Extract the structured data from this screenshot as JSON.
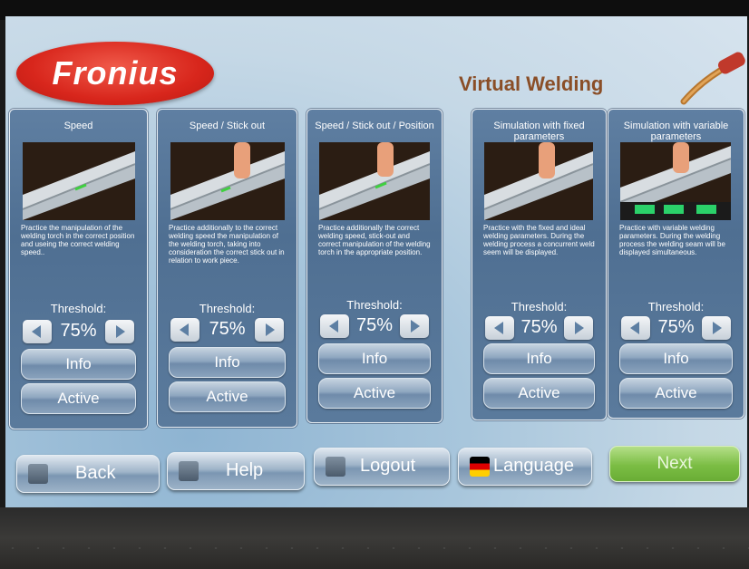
{
  "brand": {
    "logo_text": "Fronius",
    "app_title": "Virtual Welding"
  },
  "modes": [
    {
      "title": "Speed",
      "description": "Practice the manipulation of the welding torch in the correct position and useing the correct welding speed..",
      "threshold_label": "Threshold:",
      "threshold_value": "75%",
      "info_label": "Info",
      "active_label": "Active"
    },
    {
      "title": "Speed / Stick out",
      "description": "Practice additionally to the correct welding speed the manipulation of the welding torch, taking into consideration the correct stick out in relation to work piece.",
      "threshold_label": "Threshold:",
      "threshold_value": "75%",
      "info_label": "Info",
      "active_label": "Active"
    },
    {
      "title": "Speed / Stick out / Position",
      "description": "Practice additionally the correct welding speed, stick-out and correct manipulation of the welding torch in the appropriate position.",
      "threshold_label": "Threshold:",
      "threshold_value": "75%",
      "info_label": "Info",
      "active_label": "Active"
    },
    {
      "title": "Simulation with fixed parameters",
      "description": "Practice with the fixed and ideal welding parameters. During the welding process a concurrent weld seem will be displayed.",
      "threshold_label": "Threshold:",
      "threshold_value": "75%",
      "info_label": "Info",
      "active_label": "Active"
    },
    {
      "title": "Simulation with variable parameters",
      "description": "Practice with variable welding parameters. During the welding process the welding seam will be displayed simultaneous.",
      "threshold_label": "Threshold:",
      "threshold_value": "75%",
      "info_label": "Info",
      "active_label": "Active"
    }
  ],
  "navigation": {
    "back": "Back",
    "help": "Help",
    "logout": "Logout",
    "language": "Language",
    "next": "Next"
  },
  "icons": {
    "threshold_decrease": "left-arrow-icon",
    "threshold_increase": "right-arrow-icon",
    "back": "home-icon",
    "help": "question-icon",
    "logout": "key-icon",
    "language": "flag-icon"
  },
  "colors": {
    "brand_red": "#d8261c",
    "title_brown": "#8a4e27",
    "next_green": "#7bbd44",
    "panel_blue": "#5a7a9c"
  }
}
